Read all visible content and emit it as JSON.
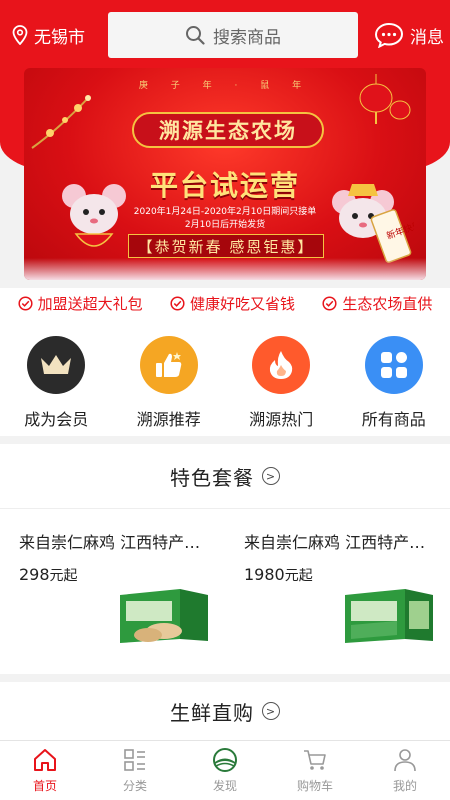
{
  "header": {
    "city": "无锡市",
    "search_placeholder": "搜索商品",
    "message_label": "消息"
  },
  "banner": {
    "top_text": "庚 子 年 · 鼠 年",
    "plaque": "溯源生态农场",
    "headline": "平台试运营",
    "dates_line1": "2020年1月24日-2020年2月10日期间只接单",
    "dates_line2": "2月10日后开始发货",
    "slogan": "【恭贺新春 感恩钜惠】",
    "scroll_text": "新年快乐"
  },
  "benefits": [
    "加盟送超大礼包",
    "健康好吃又省钱",
    "生态农场直供"
  ],
  "categories": [
    {
      "label": "成为会员",
      "icon": "crown-icon",
      "color": "#2b2b2b"
    },
    {
      "label": "溯源推荐",
      "icon": "thumbs-up-icon",
      "color": "#f5a623"
    },
    {
      "label": "溯源热门",
      "icon": "flame-icon",
      "color": "#ff5a2c"
    },
    {
      "label": "所有商品",
      "icon": "grid-icon",
      "color": "#3a8ff5"
    }
  ],
  "sections": {
    "featured_title": "特色套餐",
    "fresh_title": "生鲜直购"
  },
  "packages": [
    {
      "name": "来自崇仁麻鸡 江西特产…",
      "price": "298",
      "unit": "元起"
    },
    {
      "name": "来自崇仁麻鸡 江西特产…",
      "price": "1980",
      "unit": "元起"
    }
  ],
  "tabbar": [
    {
      "label": "首页",
      "icon": "home-icon",
      "active": true
    },
    {
      "label": "分类",
      "icon": "category-icon",
      "active": false
    },
    {
      "label": "发现",
      "icon": "discover-icon",
      "active": false
    },
    {
      "label": "购物车",
      "icon": "cart-icon",
      "active": false
    },
    {
      "label": "我的",
      "icon": "user-icon",
      "active": false
    }
  ],
  "colors": {
    "brand_red": "#e8141b",
    "banner_gold": "#f5c341"
  }
}
